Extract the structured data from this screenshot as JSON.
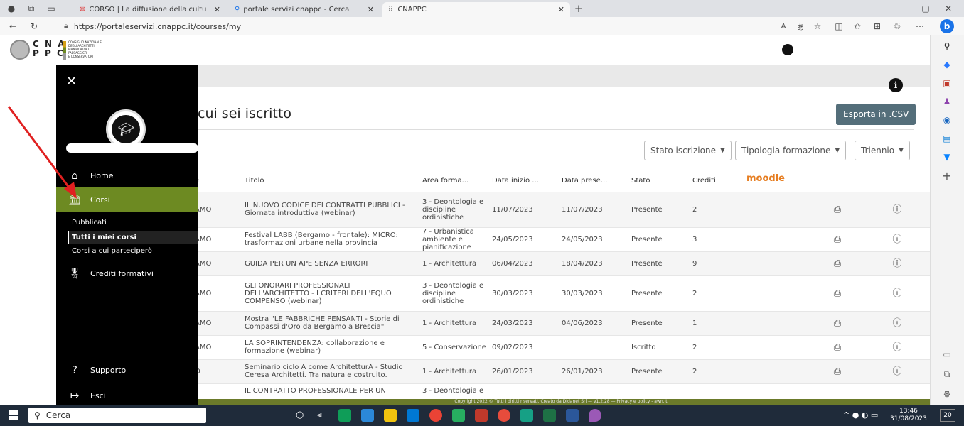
{
  "browser": {
    "tabs": [
      {
        "title": "CORSO | La diffusione della cultu"
      },
      {
        "title": "portale servizi cnappc - Cerca"
      },
      {
        "title": "CNAPPC"
      }
    ],
    "url": "https://portaleservizi.cnappc.it/courses/my"
  },
  "site": {
    "logo_letters": "C N A\nP P C",
    "logo_text": "CONSIGLIO NAZIONALE\nDEGLI ARCHITETTI\nPIANIFICATORI\nPAESAGGISTI\nE CONSERVATORI"
  },
  "sidebar": {
    "items": [
      {
        "label": "Home",
        "icon": "home-icon"
      },
      {
        "label": "Corsi",
        "icon": "bank-icon"
      },
      {
        "label": "Crediti formativi",
        "icon": "award-icon"
      },
      {
        "label": "Supporto",
        "icon": "help-icon"
      },
      {
        "label": "Esci",
        "icon": "logout-icon"
      }
    ],
    "subitems": [
      "Pubblicati",
      "Tutti i miei corsi",
      "Corsi a cui parteciperò"
    ]
  },
  "main": {
    "title": "cui sei iscritto",
    "export_label": "Esporta in .CSV",
    "filters": [
      "Stato iscrizione",
      "Tipologia formazione",
      "Triennio"
    ],
    "moodle": "moodle",
    "columns": [
      "e",
      "Titolo",
      "Area forma...",
      "Data inizio ...",
      "Data prese...",
      "Stato",
      "Crediti"
    ],
    "rows": [
      {
        "org": "AMO",
        "title": "IL NUOVO CODICE DEI CONTRATTI PUBBLICI - Giornata introduttiva (webinar)",
        "area": "3 - Deontologia e discipline ordinistiche",
        "start": "11/07/2023",
        "pres": "11/07/2023",
        "stato": "Presente",
        "crediti": "2"
      },
      {
        "org": "AMO",
        "title": "Festival LABB (Bergamo - frontale): MICRO: trasformazioni urbane nella provincia",
        "area": "7 - Urbanistica ambiente e pianificazione",
        "start": "24/05/2023",
        "pres": "24/05/2023",
        "stato": "Presente",
        "crediti": "3"
      },
      {
        "org": "AMO",
        "title": "GUIDA PER UN APE SENZA ERRORI",
        "area": "1 - Architettura",
        "start": "06/04/2023",
        "pres": "18/04/2023",
        "stato": "Presente",
        "crediti": "9"
      },
      {
        "org": "AMO",
        "title": "GLI ONORARI PROFESSIONALI DELL'ARCHITETTO - I CRITERI DELL'EQUO COMPENSO (webinar)",
        "area": "3 - Deontologia e discipline ordinistiche",
        "start": "30/03/2023",
        "pres": "30/03/2023",
        "stato": "Presente",
        "crediti": "2"
      },
      {
        "org": "AMO",
        "title": "Mostra \"LE FABBRICHE PENSANTI - Storie di Compassi d'Oro da Bergamo a Brescia\"",
        "area": "1 - Architettura",
        "start": "24/03/2023",
        "pres": "04/06/2023",
        "stato": "Presente",
        "crediti": "1"
      },
      {
        "org": "AMO",
        "title": "LA SOPRINTENDENZA: collaborazione e formazione (webinar)",
        "area": "5 - Conservazione",
        "start": "09/02/2023",
        "pres": "",
        "stato": "Iscritto",
        "crediti": "2"
      },
      {
        "org": "O",
        "title": "Seminario ciclo A come ArchitetturA - Studio Ceresa Architetti. Tra natura e costruito.",
        "area": "1 - Architettura",
        "start": "26/01/2023",
        "pres": "26/01/2023",
        "stato": "Presente",
        "crediti": "2"
      },
      {
        "org": "",
        "title": "IL CONTRATTO PROFESSIONALE PER UN",
        "area": "3 - Deontologia e",
        "start": "",
        "pres": "",
        "stato": "",
        "crediti": ""
      }
    ],
    "footer": "Copyright 2022 © Tutti i diritti riservati. Creato da Didanet Srl — v1.2.28 — Privacy e policy - awn.it"
  },
  "taskbar": {
    "search": "Cerca",
    "time": "13:46",
    "date": "31/08/2023",
    "notif": "20"
  },
  "colors": {
    "accent": "#6d8a22",
    "sidebar": "#000000",
    "export": "#546e7a"
  }
}
